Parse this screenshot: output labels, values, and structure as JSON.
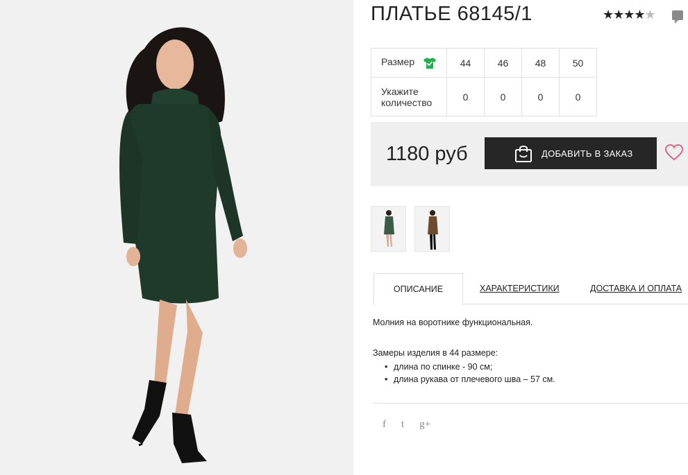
{
  "product": {
    "title": "ПЛАТЬЕ 68145/1",
    "rating_stars": "★★★★",
    "rating_half": "★",
    "rating_value": 4.5,
    "price": "1180 руб",
    "add_to_order_label": "ДОБАВИТЬ В ЗАКАЗ"
  },
  "sizes": {
    "header_label": "Размер",
    "quantity_label": "Укажите количество",
    "columns": [
      {
        "size": "44",
        "qty": "0"
      },
      {
        "size": "46",
        "qty": "0"
      },
      {
        "size": "48",
        "qty": "0"
      },
      {
        "size": "50",
        "qty": "0"
      }
    ]
  },
  "thumbnails": [
    {
      "name": "green-dress-thumbnail",
      "color": "#3c5a48"
    },
    {
      "name": "brown-dress-thumbnail",
      "color": "#6e4a2f"
    }
  ],
  "tabs": [
    {
      "label": "ОПИСАНИЕ",
      "active": true
    },
    {
      "label": "ХАРАКТЕРИСТИКИ",
      "active": false
    },
    {
      "label": "ДОСТАВКА И ОПЛАТА",
      "active": false
    }
  ],
  "description": {
    "line1": "Молния на воротнике функциональная.",
    "line2": "Замеры изделия в 44 размере:",
    "bullets": [
      "длина по спинке - 90 см;",
      "длина рукава от плечевого шва – 57 см."
    ]
  },
  "social": {
    "facebook": "f",
    "twitter": "t",
    "googleplus": "g+"
  },
  "colors": {
    "dark_button": "#262626",
    "heart": "#d9678a",
    "size_icon": "#23b14d",
    "dress": "#1f3a2a"
  }
}
